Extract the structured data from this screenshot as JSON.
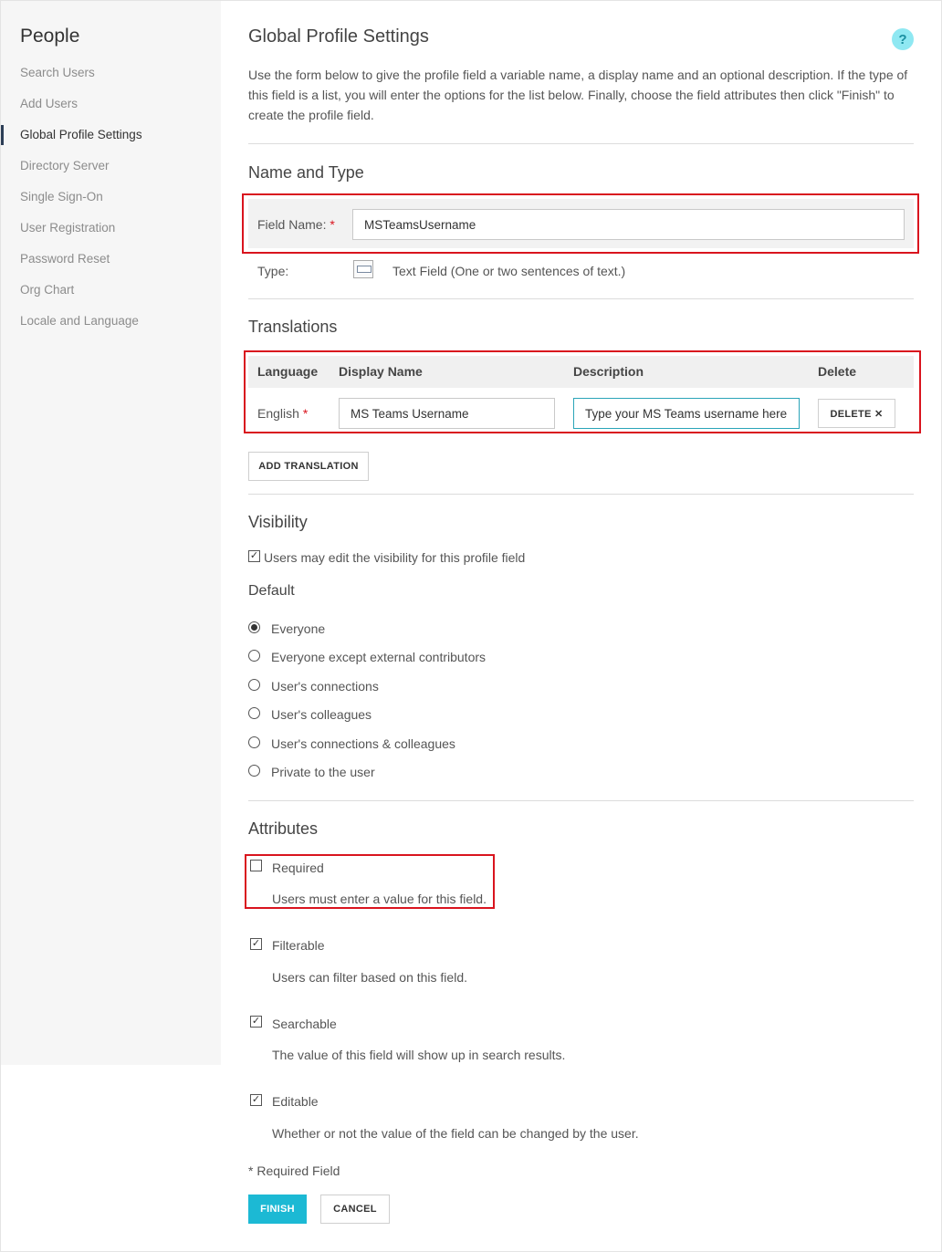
{
  "sidebar": {
    "title": "People",
    "items": [
      {
        "label": "Search Users"
      },
      {
        "label": "Add Users"
      },
      {
        "label": "Global Profile Settings"
      },
      {
        "label": "Directory Server"
      },
      {
        "label": "Single Sign-On"
      },
      {
        "label": "User Registration"
      },
      {
        "label": "Password Reset"
      },
      {
        "label": "Org Chart"
      },
      {
        "label": "Locale and Language"
      }
    ],
    "active_index": 2
  },
  "header": {
    "title": "Global Profile Settings",
    "help_icon": "?",
    "intro": "Use the form below to give the profile field a variable name, a display name and an optional description. If the type of this field is a list, you will enter the options for the list below. Finally, choose the field attributes then click \"Finish\" to create the profile field."
  },
  "name_type": {
    "heading": "Name and Type",
    "field_name_label": "Field Name:",
    "required_mark": "*",
    "field_name_value": "MSTeamsUsername",
    "type_label": "Type:",
    "type_icon": "text-field-icon",
    "type_value": "Text Field (One or two sentences of text.)"
  },
  "translations": {
    "heading": "Translations",
    "columns": [
      "Language",
      "Display Name",
      "Description",
      "Delete"
    ],
    "rows": [
      {
        "language": "English",
        "required_mark": "*",
        "display_name": "MS Teams Username",
        "description": "Type your MS Teams username here",
        "delete_label": "DELETE ✕"
      }
    ],
    "add_button": "ADD TRANSLATION"
  },
  "visibility": {
    "heading": "Visibility",
    "users_may_edit_label": "Users may edit the visibility for this profile field",
    "users_may_edit_checked": true,
    "default_heading": "Default",
    "options": [
      {
        "label": "Everyone",
        "selected": true
      },
      {
        "label": "Everyone except external contributors",
        "selected": false
      },
      {
        "label": "User's connections",
        "selected": false
      },
      {
        "label": "User's colleagues",
        "selected": false
      },
      {
        "label": "User's connections & colleagues",
        "selected": false
      },
      {
        "label": "Private to the user",
        "selected": false
      }
    ]
  },
  "attributes": {
    "heading": "Attributes",
    "items": [
      {
        "label": "Required",
        "description": "Users must enter a value for this field.",
        "checked": false
      },
      {
        "label": "Filterable",
        "description": "Users can filter based on this field.",
        "checked": true
      },
      {
        "label": "Searchable",
        "description": "The value of this field will show up in search results.",
        "checked": true
      },
      {
        "label": "Editable",
        "description": "Whether or not the value of the field can be changed by the user.",
        "checked": true
      }
    ]
  },
  "footer": {
    "required_note": "* Required Field",
    "finish_label": "FINISH",
    "cancel_label": "CANCEL"
  },
  "colors": {
    "accent": "#1cb9d4",
    "highlight_box": "#d9141e",
    "active_nav_bar": "#2c3e56",
    "sidebar_bg": "#f6f6f6"
  }
}
